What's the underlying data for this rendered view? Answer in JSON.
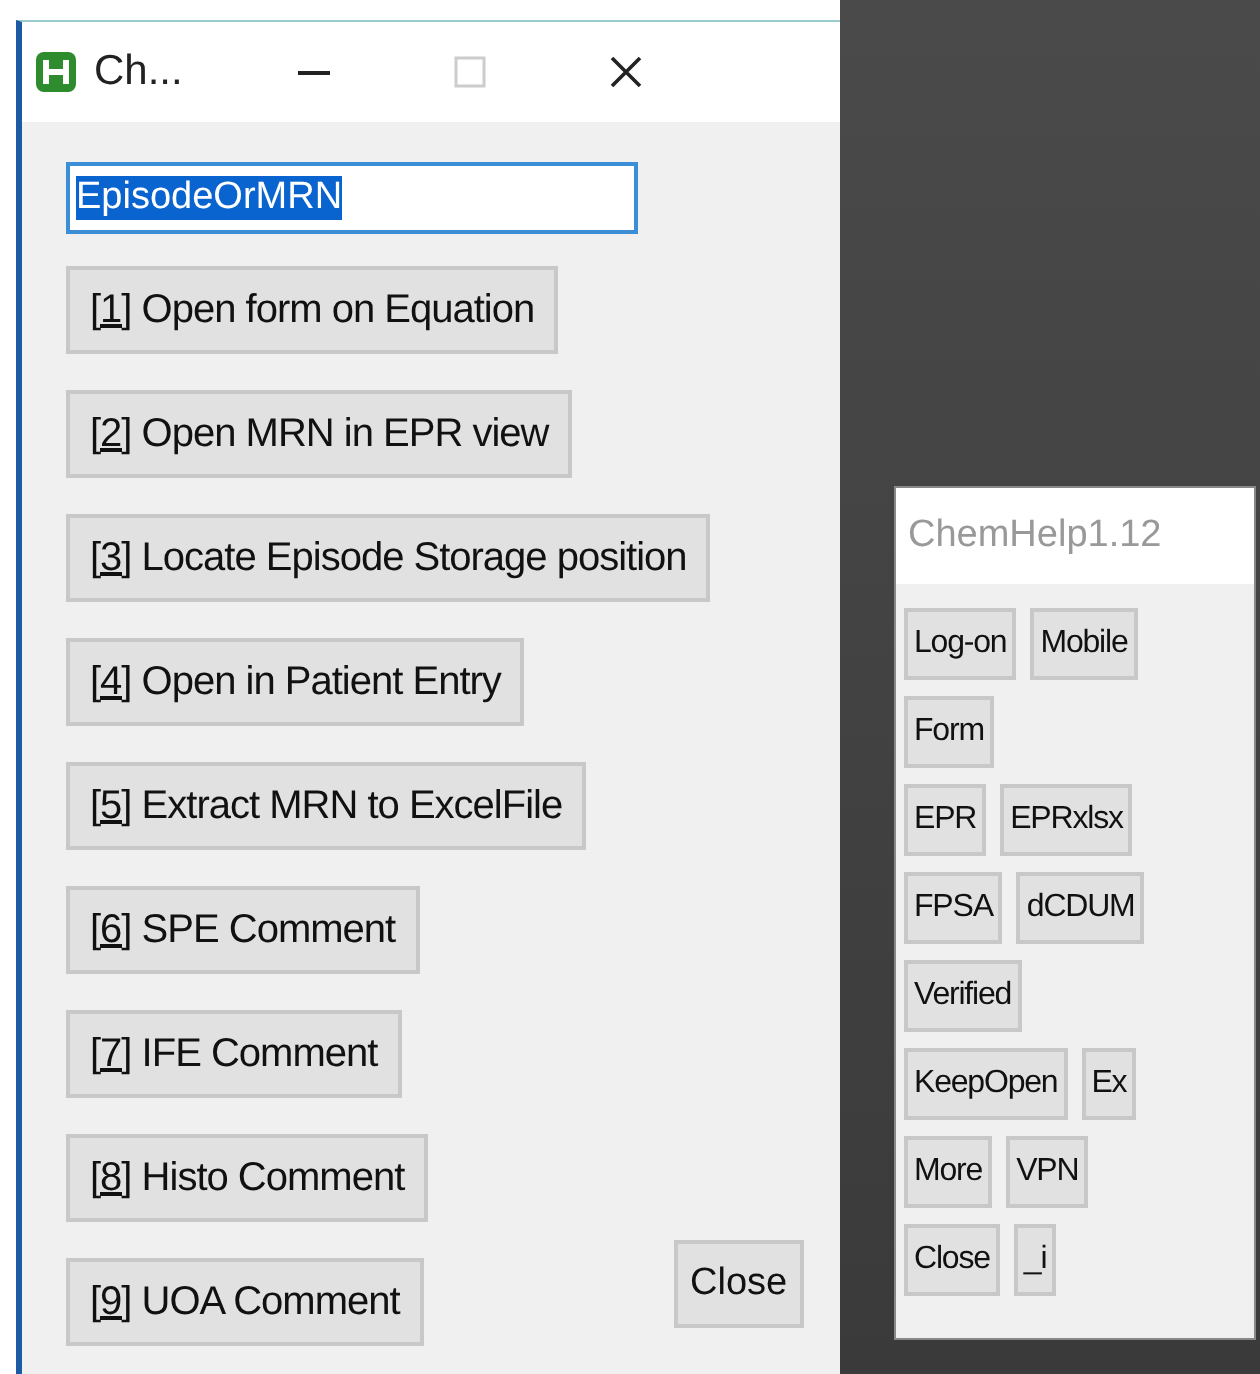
{
  "window": {
    "title": "Ch...",
    "maximize_disabled": true
  },
  "episode_field": {
    "value": "EpisodeOrMRN",
    "value_selected": true
  },
  "actions": [
    {
      "key": "[1]",
      "label": "Open form on Equation"
    },
    {
      "key": "[2]",
      "label": "Open MRN in EPR view"
    },
    {
      "key": "[3]",
      "label": "Locate Episode Storage position"
    },
    {
      "key": "[4]",
      "label": "Open in Patient Entry"
    },
    {
      "key": "[5]",
      "label": "Extract MRN to ExcelFile"
    },
    {
      "key": "[6]",
      "label": "SPE Comment"
    },
    {
      "key": "[7]",
      "label": "IFE Comment"
    },
    {
      "key": "[8]",
      "label": "Histo Comment"
    },
    {
      "key": "[9]",
      "label": "UOA Comment"
    }
  ],
  "close_button": "Close",
  "side_panel": {
    "title": "ChemHelp1.12",
    "rows": [
      [
        "Log-on",
        "Mobile"
      ],
      [
        "Form"
      ],
      [
        "EPR",
        "EPRxlsx"
      ],
      [
        "FPSA",
        "dCDUM"
      ],
      [
        "Verified"
      ],
      [
        "KeepOpen",
        "Ex"
      ],
      [
        "More",
        "VPN"
      ],
      [
        "Close",
        "_i"
      ]
    ]
  }
}
